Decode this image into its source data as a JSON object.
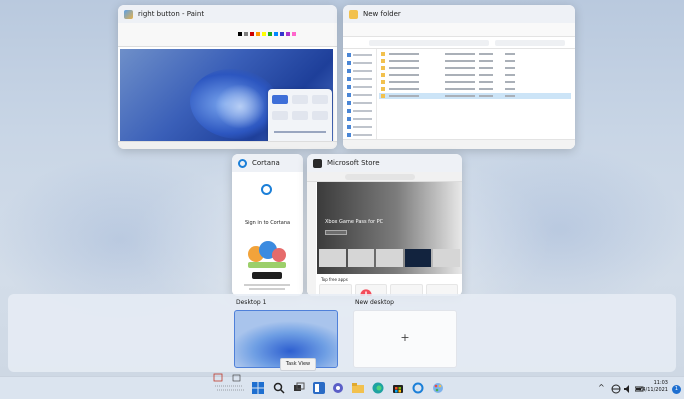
{
  "windows": {
    "paint": {
      "title": "right button - Paint"
    },
    "explorer": {
      "title": "New folder"
    },
    "cortana": {
      "title": "Cortana",
      "sign_in": "Sign in to Cortana"
    },
    "store": {
      "title": "Microsoft Store",
      "hero_text": "Xbox Game Pass for PC",
      "top_apps": "Top free apps"
    }
  },
  "desktops": {
    "desktop1": {
      "label": "Desktop 1"
    },
    "new_desktop": {
      "label": "New desktop",
      "plus": "+"
    }
  },
  "tooltip": "Task View",
  "taskbar": {
    "tray_chevron": "^",
    "time": "11:03",
    "date": "24/11/2021",
    "notification_count": "1"
  },
  "colors": {
    "accent": "#1e6fd0",
    "taskbar": "#dbe4ef"
  },
  "icons": [
    "start-icon",
    "search-icon",
    "task-view-icon",
    "widgets-icon",
    "chat-icon",
    "file-explorer-icon",
    "edge-icon",
    "store-icon",
    "cortana-icon",
    "paint-icon"
  ]
}
